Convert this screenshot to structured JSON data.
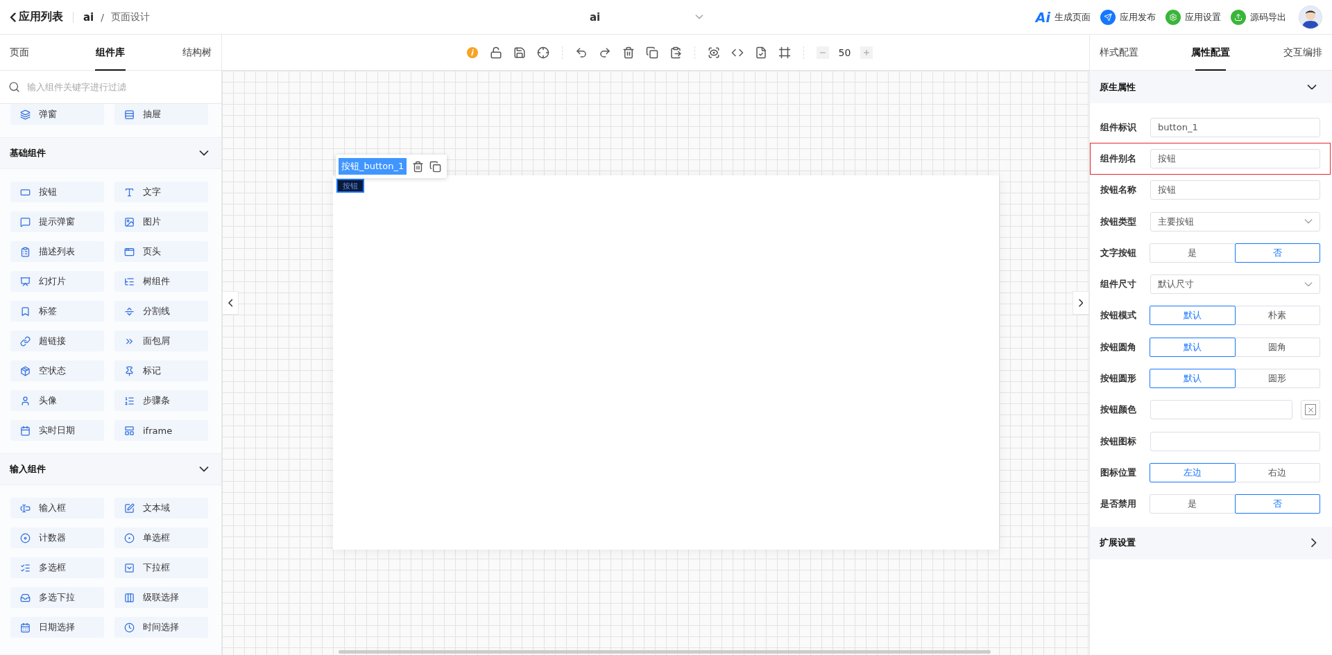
{
  "header": {
    "back_label": "应用列表",
    "app": "ai",
    "separator": "/",
    "page": "页面设计",
    "center_title": "ai",
    "actions": [
      {
        "kind": "ai",
        "logo": "Ai",
        "label": "生成页面"
      },
      {
        "kind": "publish",
        "label": "应用发布"
      },
      {
        "kind": "settings",
        "label": "应用设置"
      },
      {
        "kind": "export",
        "label": "源码导出"
      }
    ]
  },
  "left_tabs": [
    {
      "label": "页面",
      "selected": false
    },
    {
      "label": "组件库",
      "selected": true
    },
    {
      "label": "结构树",
      "selected": false
    }
  ],
  "search": {
    "placeholder": "输入组件关键字进行过滤"
  },
  "top_items": [
    {
      "label": "弹窗"
    },
    {
      "label": "抽屉"
    }
  ],
  "groups": [
    {
      "title": "基础组件",
      "expanded": true,
      "items": [
        {
          "label": "按钮"
        },
        {
          "label": "文字"
        },
        {
          "label": "提示弹窗"
        },
        {
          "label": "图片"
        },
        {
          "label": "描述列表"
        },
        {
          "label": "页头"
        },
        {
          "label": "幻灯片"
        },
        {
          "label": "树组件"
        },
        {
          "label": "标签"
        },
        {
          "label": "分割线"
        },
        {
          "label": "超链接"
        },
        {
          "label": "面包屑"
        },
        {
          "label": "空状态"
        },
        {
          "label": "标记"
        },
        {
          "label": "头像"
        },
        {
          "label": "步骤条"
        },
        {
          "label": "实时日期"
        },
        {
          "label": "iframe"
        }
      ]
    },
    {
      "title": "输入组件",
      "expanded": true,
      "items": [
        {
          "label": "输入框"
        },
        {
          "label": "文本域"
        },
        {
          "label": "计数器"
        },
        {
          "label": "单选框"
        },
        {
          "label": "多选框"
        },
        {
          "label": "下拉框"
        },
        {
          "label": "多选下拉"
        },
        {
          "label": "级联选择"
        },
        {
          "label": "日期选择"
        },
        {
          "label": "时间选择"
        }
      ]
    }
  ],
  "toolbar": {
    "zoom": "50"
  },
  "canvas": {
    "selection_label": "按钮_button_1",
    "button_text": "按钮"
  },
  "right_tabs": [
    {
      "label": "样式配置",
      "selected": false
    },
    {
      "label": "属性配置",
      "selected": true
    },
    {
      "label": "交互编排",
      "selected": false
    }
  ],
  "properties": {
    "title": "原生属性",
    "expanded": true,
    "fields": [
      {
        "label": "组件标识",
        "kind": "text",
        "value": "button_1",
        "highlighted": false
      },
      {
        "label": "组件别名",
        "kind": "text",
        "value": "按钮",
        "highlighted": true
      },
      {
        "label": "按钮名称",
        "kind": "text",
        "value": "按钮",
        "highlighted": false
      },
      {
        "label": "按钮类型",
        "kind": "select",
        "value": "主要按钮",
        "highlighted": false
      },
      {
        "label": "文字按钮",
        "kind": "segmented",
        "highlighted": false,
        "options": [
          {
            "label": "是",
            "selected": false
          },
          {
            "label": "否",
            "selected": true
          }
        ]
      },
      {
        "label": "组件尺寸",
        "kind": "select",
        "value": "默认尺寸",
        "highlighted": false
      },
      {
        "label": "按钮模式",
        "kind": "segmented",
        "highlighted": false,
        "options": [
          {
            "label": "默认",
            "selected": true
          },
          {
            "label": "朴素",
            "selected": false
          }
        ]
      },
      {
        "label": "按钮圆角",
        "kind": "segmented",
        "highlighted": false,
        "options": [
          {
            "label": "默认",
            "selected": true
          },
          {
            "label": "圆角",
            "selected": false
          }
        ]
      },
      {
        "label": "按钮圆形",
        "kind": "segmented",
        "highlighted": false,
        "options": [
          {
            "label": "默认",
            "selected": true
          },
          {
            "label": "圆形",
            "selected": false
          }
        ]
      },
      {
        "label": "按钮颜色",
        "kind": "color",
        "highlighted": false
      },
      {
        "label": "按钮图标",
        "kind": "text",
        "highlighted": false
      },
      {
        "label": "图标位置",
        "kind": "segmented",
        "highlighted": false,
        "options": [
          {
            "label": "左边",
            "selected": true
          },
          {
            "label": "右边",
            "selected": false
          }
        ]
      },
      {
        "label": "是否禁用",
        "kind": "segmented",
        "highlighted": false,
        "options": [
          {
            "label": "是",
            "selected": false
          },
          {
            "label": "否",
            "selected": true
          }
        ]
      }
    ]
  },
  "extension": {
    "title": "扩展设置",
    "expanded": false
  }
}
